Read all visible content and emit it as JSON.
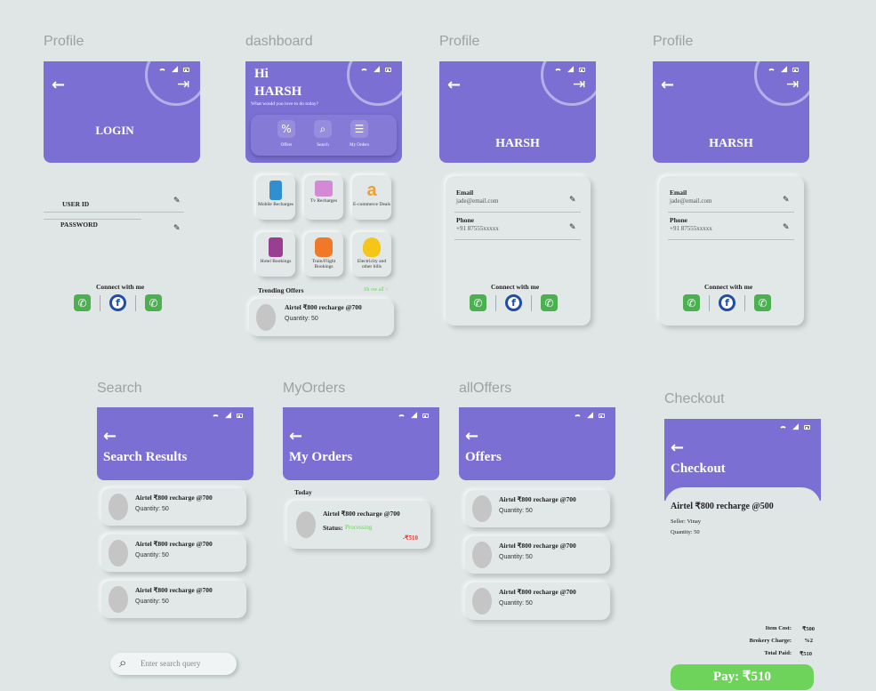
{
  "frames": {
    "profile1": "Profile",
    "dashboard": "dashboard",
    "profile2": "Profile",
    "profile3": "Profile",
    "search": "Search",
    "myorders": "MyOrders",
    "alloffers": "allOffers",
    "checkout": "Checkout"
  },
  "login": {
    "title": "LOGIN",
    "user_id_label": "USER ID",
    "password_label": "PASSWORD"
  },
  "connect": {
    "label": "Connect with me"
  },
  "dashboard": {
    "greeting": "Hi",
    "name": "HARSH",
    "subtitle": "What would you love to do today?",
    "actions": [
      {
        "label": "Offers",
        "icon": "percent-icon"
      },
      {
        "label": "Search",
        "icon": "search-icon"
      },
      {
        "label": "My Orders",
        "icon": "menu-icon"
      }
    ],
    "tiles": [
      {
        "label": "Mobile Recharges",
        "icon": "mobile-icon",
        "color": "#2f8fd1"
      },
      {
        "label": "Tv Recharges",
        "icon": "tv-icon",
        "color": "#d28ad6"
      },
      {
        "label": "E-commerce Deals",
        "icon": "amazon-icon",
        "color": "#f0a030"
      },
      {
        "label": "Hotel Bookings",
        "icon": "hotel-icon",
        "color": "#9a3e92"
      },
      {
        "label": "Train/Flight Bookings",
        "icon": "train-icon",
        "color": "#f07828"
      },
      {
        "label": "Electricity and other bills",
        "icon": "bulb-icon",
        "color": "#f5c518"
      }
    ],
    "trending_label": "Trending Offers",
    "show_all": "Sh ow all >"
  },
  "offer": {
    "title": "Airtel ₹800 recharge @700",
    "quantity": "Quantity: 50"
  },
  "profile": {
    "name": "HARSH",
    "email_label": "Email",
    "email_value": "jade@email.com",
    "phone_label": "Phone",
    "phone_value": "+91 87555xxxxx"
  },
  "search": {
    "title": "Search Results",
    "placeholder": "Enter search query"
  },
  "myorders": {
    "title": "My Orders",
    "today": "Today",
    "status_label": "Status:",
    "status_value": "Processing",
    "amount": "-₹510"
  },
  "alloffers": {
    "title": "Offers"
  },
  "checkout": {
    "title": "Checkout",
    "item_title": "Airtel ₹800 recharge @500",
    "seller": "Seller: Vinay",
    "quantity": "Quantity: 50",
    "item_cost_label": "Item Cost:",
    "item_cost": "₹500",
    "brokery_label": "Brokery Charge:",
    "brokery": "%2",
    "total_label": "Total Paid:",
    "total": "₹510",
    "pay_label": "Pay: ₹510"
  },
  "colors": {
    "primary": "#7b6fd3",
    "background": "#dfe6e5",
    "accent_green": "#6ed35a",
    "negative_red": "#e53935"
  }
}
